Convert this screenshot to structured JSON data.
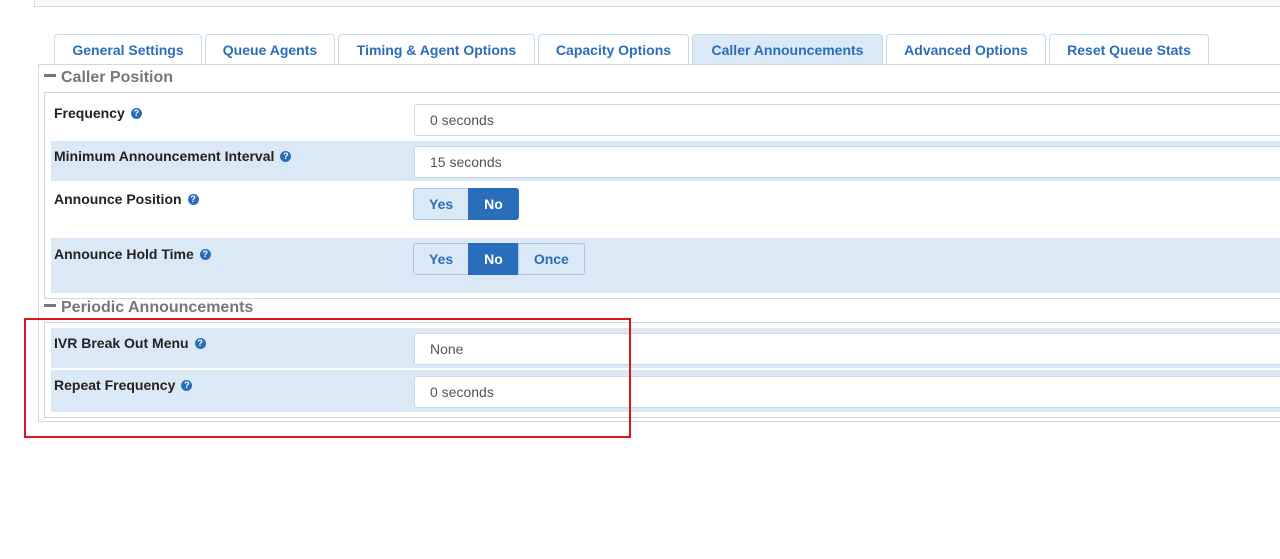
{
  "tabs": [
    {
      "label": "General Settings",
      "active": false
    },
    {
      "label": "Queue Agents",
      "active": false
    },
    {
      "label": "Timing & Agent Options",
      "active": false
    },
    {
      "label": "Capacity Options",
      "active": false
    },
    {
      "label": "Caller Announcements",
      "active": true
    },
    {
      "label": "Advanced Options",
      "active": false
    },
    {
      "label": "Reset Queue Stats",
      "active": false
    }
  ],
  "caller_position": {
    "title": "Caller Position",
    "frequency": {
      "label": "Frequency",
      "value": "0 seconds"
    },
    "min_interval": {
      "label": "Minimum Announcement Interval",
      "value": "15 seconds"
    },
    "announce_position": {
      "label": "Announce Position",
      "options": [
        "Yes",
        "No"
      ],
      "selected": "No"
    },
    "announce_hold_time": {
      "label": "Announce Hold Time",
      "options": [
        "Yes",
        "No",
        "Once"
      ],
      "selected": "No"
    }
  },
  "periodic": {
    "title": "Periodic Announcements",
    "ivr_menu": {
      "label": "IVR Break Out Menu",
      "value": "None"
    },
    "repeat_frequency": {
      "label": "Repeat Frequency",
      "value": "0 seconds"
    }
  },
  "help_glyph": "?",
  "colors": {
    "accent": "#2a6ebb",
    "row_shade": "#dbe8f6",
    "highlight_box": "#e0141e"
  }
}
